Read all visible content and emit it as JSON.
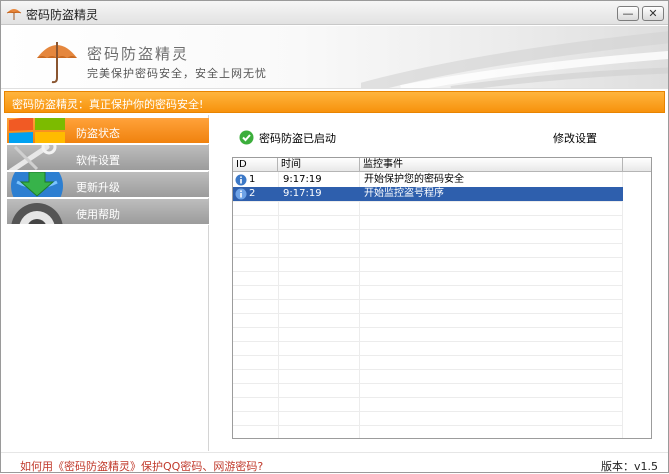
{
  "window": {
    "title": "密码防盗精灵",
    "minimize_glyph": "—",
    "close_glyph": "✕"
  },
  "banner": {
    "brand_name": "密码防盗精灵",
    "slogan": "完美保护密码安全，安全上网无忧"
  },
  "notice_bar": {
    "text": "密码防盗精灵：真正保护你的密码安全!"
  },
  "sidebar": {
    "items": [
      {
        "label": "防盗状态",
        "icon": "windows-logo-icon",
        "active": true
      },
      {
        "label": "软件设置",
        "icon": "wrench-tools-icon",
        "active": false
      },
      {
        "label": "更新升级",
        "icon": "globe-download-icon",
        "active": false
      },
      {
        "label": "使用帮助",
        "icon": "help-ring-icon",
        "active": false
      }
    ]
  },
  "status": {
    "text": "密码防盗已启动",
    "settings_link": "修改设置"
  },
  "log": {
    "columns": [
      "ID",
      "时间",
      "监控事件"
    ],
    "rows": [
      {
        "id": "1",
        "time": "9:17:19",
        "event": "开始保护您的密码安全",
        "selected": false
      },
      {
        "id": "2",
        "time": "9:17:19",
        "event": "开始监控盗号程序",
        "selected": true
      }
    ]
  },
  "footer": {
    "help_link": "如何用《密码防盗精灵》保护QQ密码、网游密码?",
    "version": "版本：v1.5"
  },
  "colors": {
    "accent_orange": "#f7920c",
    "nav_gray": "#a8a8a8",
    "selection_blue": "#2e5fad",
    "link_red": "#c0392b"
  }
}
